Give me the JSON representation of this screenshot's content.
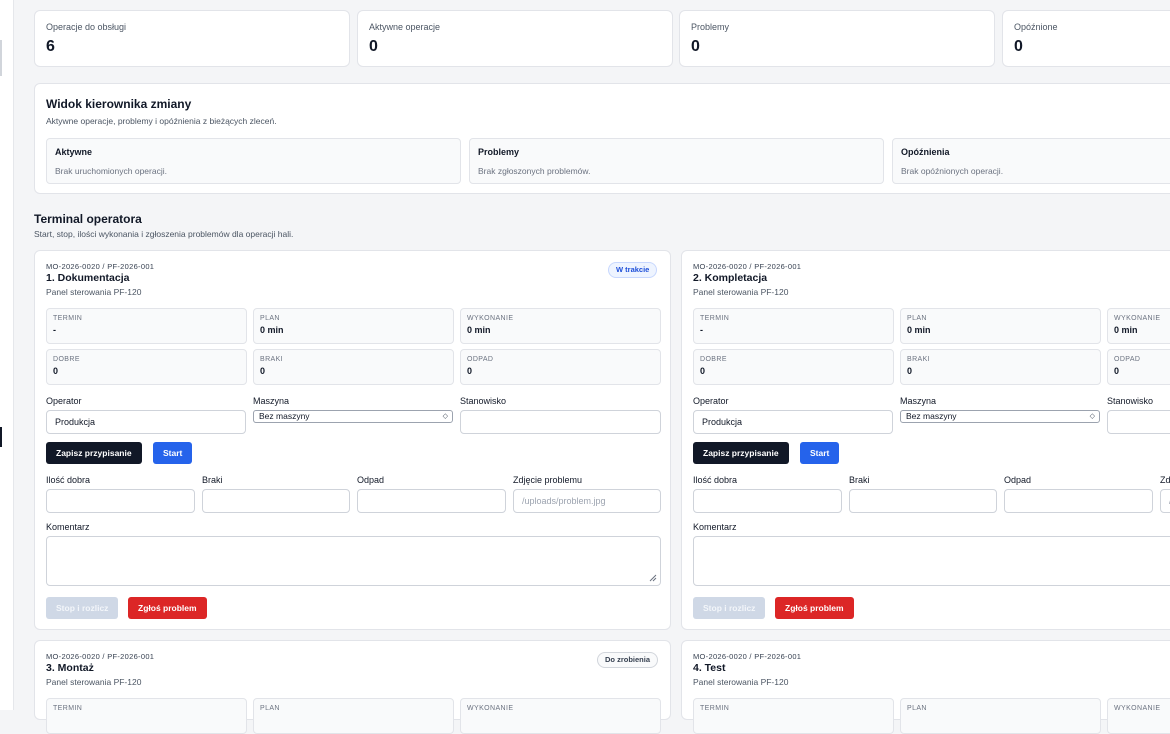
{
  "stats": [
    {
      "label": "Operacje do obsługi",
      "value": "6"
    },
    {
      "label": "Aktywne operacje",
      "value": "0"
    },
    {
      "label": "Problemy",
      "value": "0"
    },
    {
      "label": "Opóźnione",
      "value": "0"
    }
  ],
  "shift": {
    "title": "Widok kierownika zmiany",
    "subtitle": "Aktywne operacje, problemy i opóźnienia z bieżących zleceń.",
    "boxes": [
      {
        "title": "Aktywne",
        "text": "Brak uruchomionych operacji."
      },
      {
        "title": "Problemy",
        "text": "Brak zgłoszonych problemów."
      },
      {
        "title": "Opóźnienia",
        "text": "Brak opóźnionych operacji."
      }
    ]
  },
  "terminal": {
    "title": "Terminal operatora",
    "subtitle": "Start, stop, ilości wykonania i zgłoszenia problemów dla operacji hali."
  },
  "labels": {
    "termin": "TERMIN",
    "plan": "PLAN",
    "wykonanie": "WYKONANIE",
    "dobre": "DOBRE",
    "braki": "BRAKI",
    "odpad": "ODPAD",
    "operator": "Operator",
    "maszyna": "Maszyna",
    "stanowisko": "Stanowisko",
    "save_assignment": "Zapisz przypisanie",
    "start": "Start",
    "good_qty": "Ilość dobra",
    "scrap": "Braki",
    "waste": "Odpad",
    "problem_photo": "Zdjęcie problemu",
    "photo_placeholder": "/uploads/problem.jpg",
    "photo_placeholder_cut": "/",
    "problem_photo_cut": "Zd",
    "comment": "Komentarz",
    "stop": "Stop i rozlicz",
    "report_problem": "Zgłoś problem"
  },
  "operations": [
    {
      "code": "MO-2026-0020 / PF-2026-001",
      "name": "1. Dokumentacja",
      "product": "Panel sterowania PF-120",
      "status": "W trakcie",
      "termin": "-",
      "plan": "0 min",
      "wykonanie": "0 min",
      "dobre": "0",
      "braki": "0",
      "odpad": "0",
      "operator": "Produkcja",
      "machine": "Bez maszyny"
    },
    {
      "code": "MO-2026-0020 / PF-2026-001",
      "name": "2. Kompletacja",
      "product": "Panel sterowania PF-120",
      "termin": "-",
      "plan": "0 min",
      "wykonanie": "0 min",
      "dobre": "0",
      "braki": "0",
      "odpad": "0",
      "operator": "Produkcja",
      "machine": "Bez maszyny"
    },
    {
      "code": "MO-2026-0020 / PF-2026-001",
      "name": "3. Montaż",
      "product": "Panel sterowania PF-120",
      "status": "Do zrobienia"
    },
    {
      "code": "MO-2026-0020 / PF-2026-001",
      "name": "4. Test",
      "product": "Panel sterowania PF-120"
    }
  ],
  "colors": {
    "primary": "#2563eb",
    "dark": "#111827",
    "danger": "#dc2626"
  }
}
